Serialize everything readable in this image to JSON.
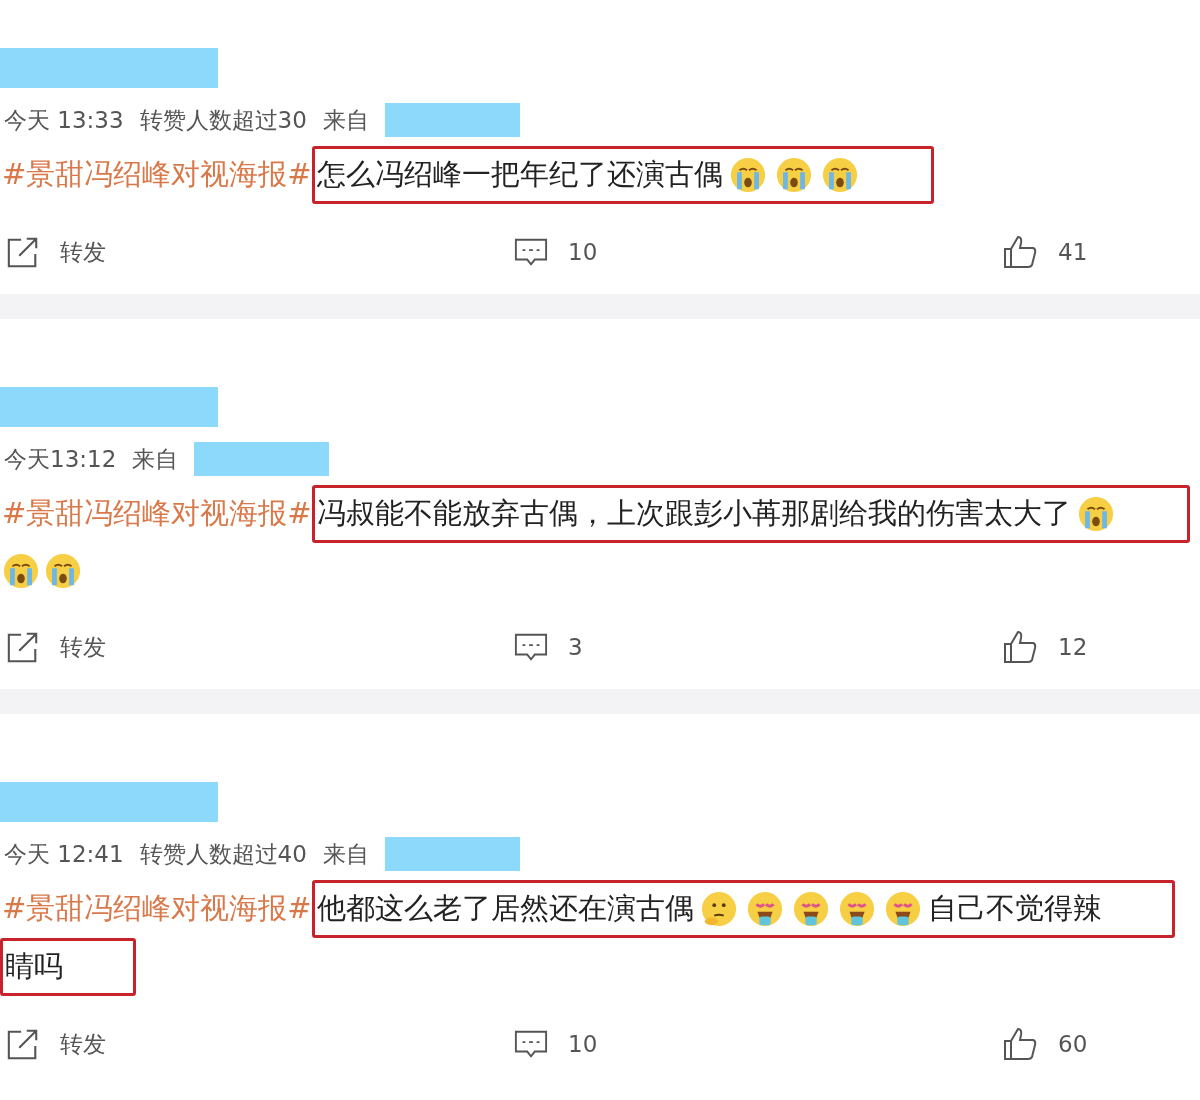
{
  "posts": [
    {
      "time": "今天 13:33",
      "reposts_note": "转赞人数超过30",
      "source_label": "来自",
      "lines": [
        {
          "plain": [
            {
              "kind": "hashtag",
              "text": "#景甜冯绍峰对视海报#"
            }
          ],
          "boxed": [
            {
              "kind": "text",
              "text": "怎么冯绍峰一把年纪了还演古偶"
            },
            {
              "kind": "crying"
            },
            {
              "kind": "crying"
            },
            {
              "kind": "crying"
            }
          ]
        }
      ],
      "repost_label": "转发",
      "comments": "10",
      "likes": "41"
    },
    {
      "time": "今天13:12",
      "source_label": "来自",
      "lines": [
        {
          "plain": [
            {
              "kind": "hashtag",
              "text": "#景甜冯绍峰对视海报#"
            }
          ],
          "boxed": [
            {
              "kind": "text",
              "text": "冯叔能不能放弃古偶，上次跟彭小苒那剧给我的伤害太大了"
            },
            {
              "kind": "crying"
            }
          ]
        },
        {
          "plain": [
            {
              "kind": "crying"
            },
            {
              "kind": "crying"
            }
          ]
        }
      ],
      "repost_label": "转发",
      "comments": "3",
      "likes": "12"
    },
    {
      "time": "今天 12:41",
      "reposts_note": "转赞人数超过40",
      "source_label": "来自",
      "lines": [
        {
          "plain": [
            {
              "kind": "hashtag",
              "text": "#景甜冯绍峰对视海报#"
            }
          ],
          "boxed": [
            {
              "kind": "text",
              "text": "他都这么老了居然还在演古偶"
            },
            {
              "kind": "thinking"
            },
            {
              "kind": "drooling"
            },
            {
              "kind": "drooling"
            },
            {
              "kind": "drooling"
            },
            {
              "kind": "drooling"
            },
            {
              "kind": "text",
              "text": "自己不觉得辣"
            }
          ]
        },
        {
          "boxed": [
            {
              "kind": "text",
              "text": "睛吗"
            }
          ]
        }
      ],
      "repost_label": "转发",
      "comments": "10",
      "likes": "60"
    }
  ]
}
